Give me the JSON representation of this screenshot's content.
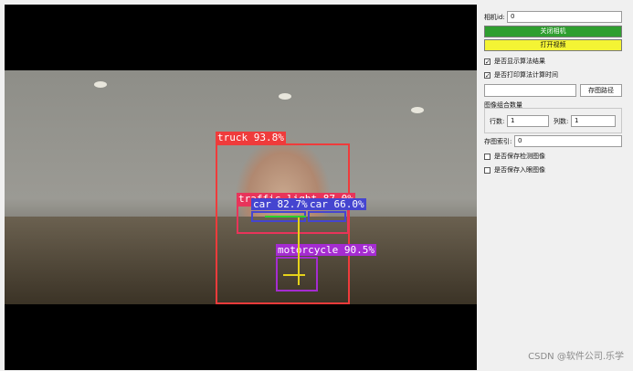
{
  "detections": [
    {
      "label": "truck 93.8%",
      "color": "#ef3b3b"
    },
    {
      "label": "traffic light 87.0%",
      "color": "#e8345a"
    },
    {
      "label": "car 82.7%",
      "color": "#4545d0"
    },
    {
      "label": "car 66.0%",
      "color": "#4545d0"
    },
    {
      "label": "motorcycle 90.5%",
      "color": "#a52cd1"
    }
  ],
  "panel": {
    "camera_id_label": "相机id:",
    "camera_id_value": "0",
    "close_camera_button": "关闭相机",
    "open_video_button": "打开视频",
    "show_result_checkbox": "是否显示算法结果",
    "show_result_checked": "✓",
    "print_time_checkbox": "是否打印算法计算时间",
    "print_time_checked": "✓",
    "save_path_value": "",
    "save_path_button": "存图路径",
    "image_group_title": "图像组合数量",
    "rows_label": "行数:",
    "rows_value": "1",
    "cols_label": "列数:",
    "cols_value": "1",
    "save_index_label": "存图索引:",
    "save_index_value": "0",
    "save_detect_checkbox": "是否保存检测图像",
    "save_input_checkbox": "是否保存入眼图像"
  },
  "watermark": "CSDN @软件公司.乐学",
  "colors": {
    "green_button": "#2f9e2f",
    "yellow_button": "#f4f434"
  }
}
